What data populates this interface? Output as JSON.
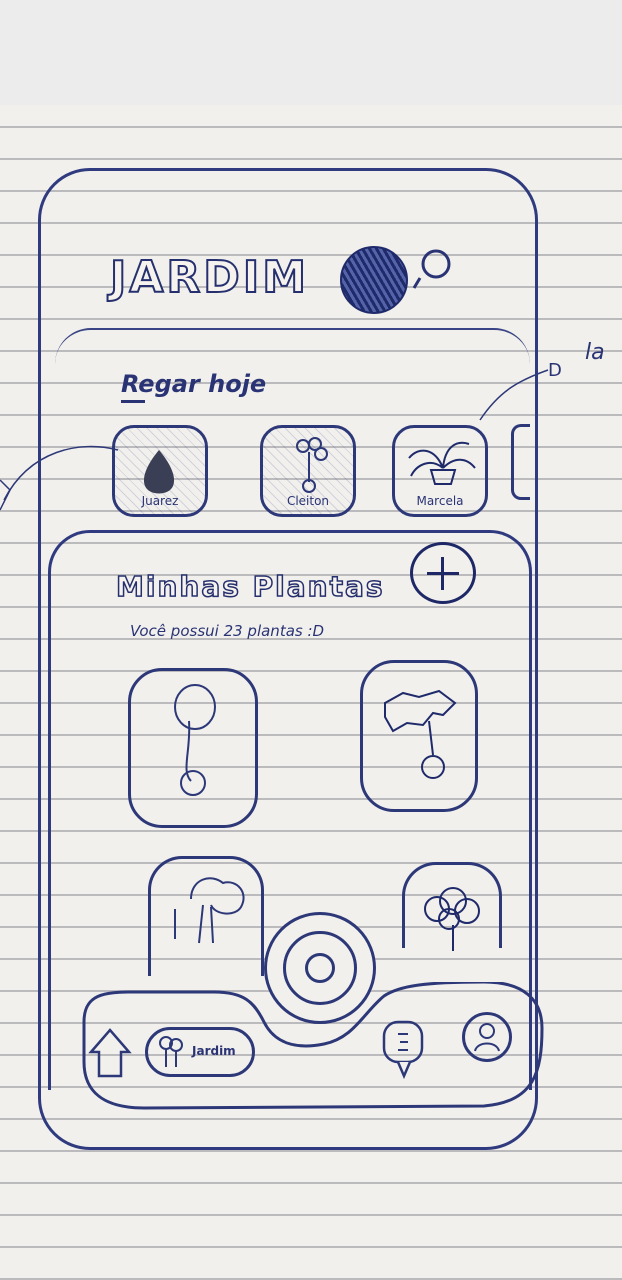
{
  "app": {
    "title": "JARDIM"
  },
  "header": {
    "avatar_icon": "user-avatar-icon",
    "search_icon": "search-icon"
  },
  "favorites": {
    "heading": "Regar hoje",
    "items": [
      {
        "label": "Juarez",
        "icon": "drop-plant-icon"
      },
      {
        "label": "Cleiton",
        "icon": "tree-plant-icon"
      },
      {
        "label": "Marcela",
        "icon": "potted-plant-icon"
      }
    ]
  },
  "plants": {
    "title": "Minhas Plantas",
    "count_text": "Você possui 23 plantas :D",
    "cards": [
      {
        "icon": "plant-sketch-icon"
      },
      {
        "icon": "plant-sketch-icon"
      },
      {
        "icon": "bonsai-icon"
      },
      {
        "icon": "round-tree-icon"
      }
    ]
  },
  "tab_bar": {
    "items": [
      {
        "label": "",
        "icon": "home-icon"
      },
      {
        "label": "Jardim",
        "icon": "garden-icon"
      },
      {
        "label": "",
        "icon": "chat-icon"
      },
      {
        "label": "",
        "icon": "profile-icon"
      }
    ],
    "center_icon": "camera-scan-icon"
  },
  "annotations": {
    "right_letter": "D",
    "right_note": "la"
  },
  "colors": {
    "ink": "#2c3777",
    "paper": "#f2f0ed",
    "ruling": "#787882"
  }
}
